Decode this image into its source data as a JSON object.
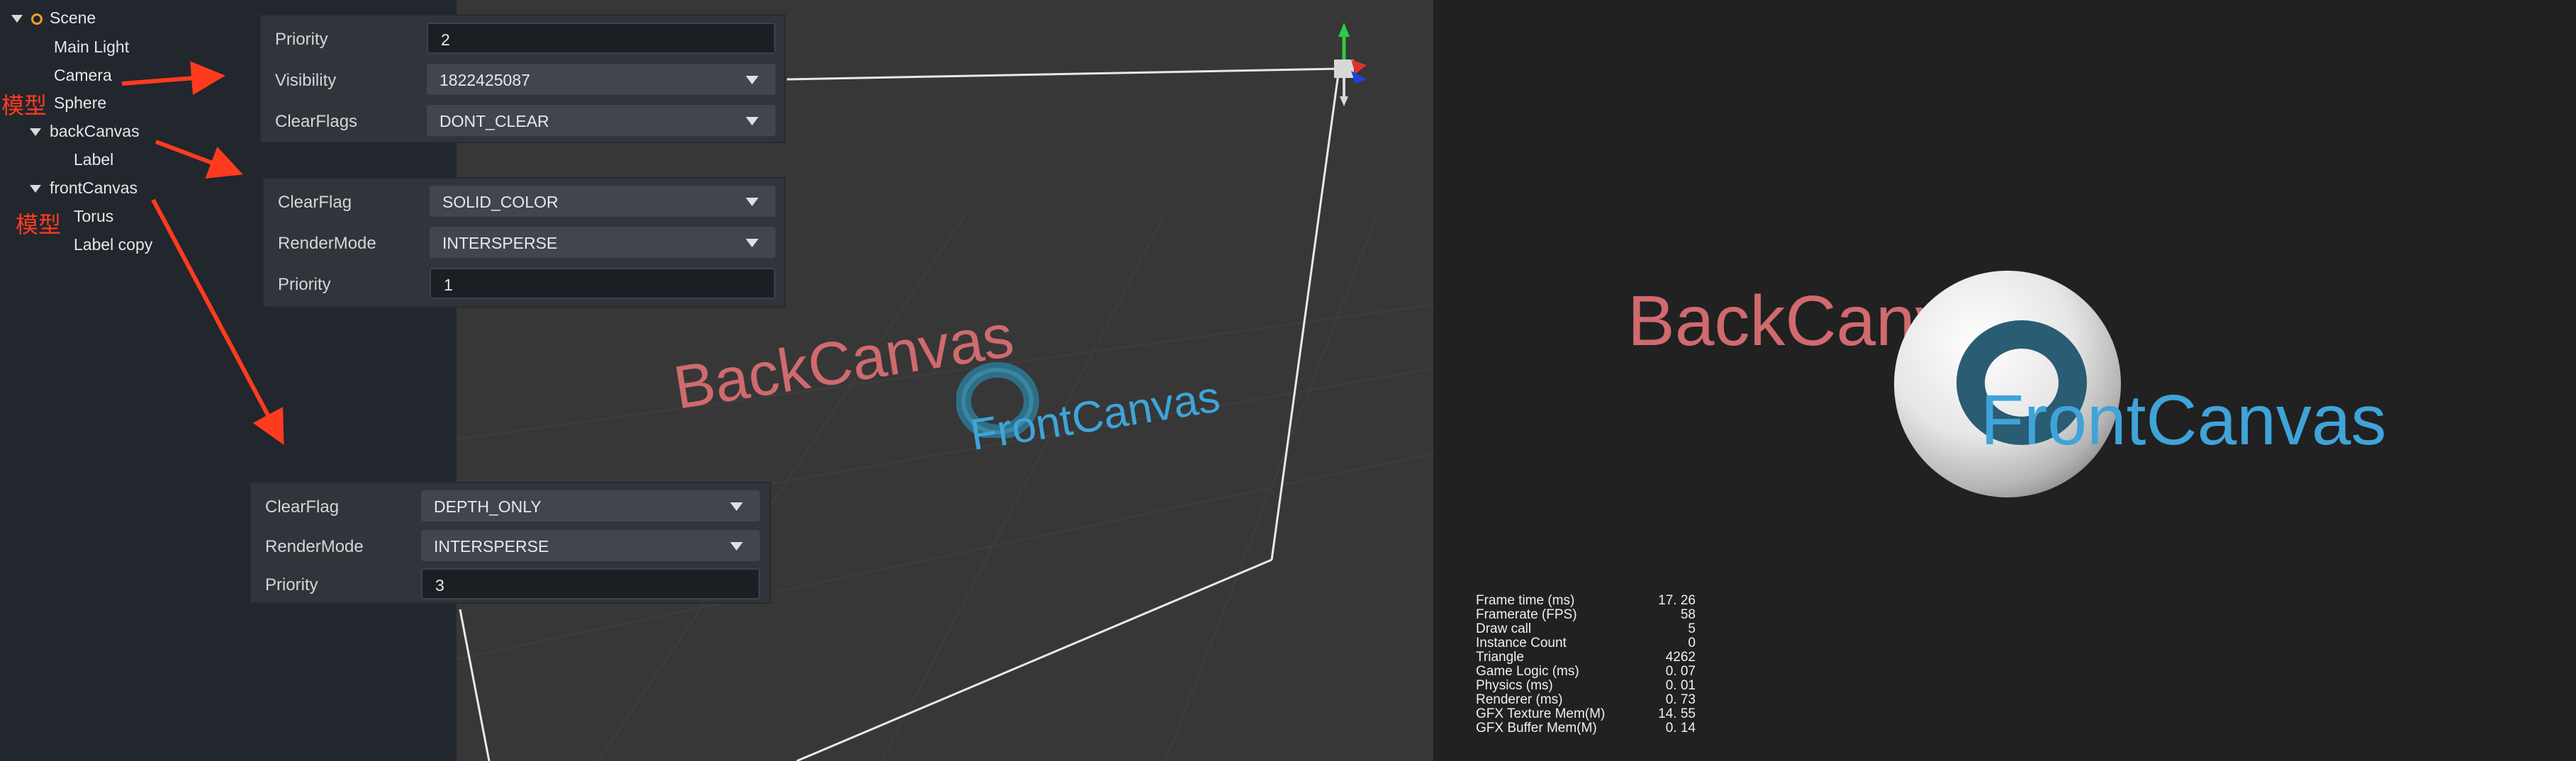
{
  "hierarchy": {
    "items": [
      "Scene",
      "Main Light",
      "Camera",
      "Sphere",
      "backCanvas",
      "Label",
      "frontCanvas",
      "Torus",
      "Label copy"
    ],
    "annotations": [
      "模型",
      "模型"
    ]
  },
  "camera_panel": {
    "rows": [
      {
        "label": "Priority",
        "value": "2"
      },
      {
        "label": "Visibility",
        "value": "1822425087"
      },
      {
        "label": "ClearFlags",
        "value": "DONT_CLEAR"
      }
    ]
  },
  "back_canvas_panel": {
    "rows": [
      {
        "label": "ClearFlag",
        "value": "SOLID_COLOR"
      },
      {
        "label": "RenderMode",
        "value": "INTERSPERSE"
      },
      {
        "label": "Priority",
        "value": "1"
      }
    ]
  },
  "front_canvas_panel": {
    "rows": [
      {
        "label": "ClearFlag",
        "value": "DEPTH_ONLY"
      },
      {
        "label": "RenderMode",
        "value": "INTERSPERSE"
      },
      {
        "label": "Priority",
        "value": "3"
      }
    ]
  },
  "scene": {
    "back_text": "BackCanvas",
    "front_text": "FrontCanvas"
  },
  "game": {
    "back_text": "BackCanvas",
    "front_text": "FrontCanvas"
  },
  "stats": [
    {
      "label": "Frame time (ms)",
      "value": "17. 26"
    },
    {
      "label": "Framerate (FPS)",
      "value": "58"
    },
    {
      "label": "Draw call",
      "value": "5"
    },
    {
      "label": "Instance Count",
      "value": "0"
    },
    {
      "label": "Triangle",
      "value": "4262"
    },
    {
      "label": "Game Logic (ms)",
      "value": "0. 07"
    },
    {
      "label": "Physics (ms)",
      "value": "0. 01"
    },
    {
      "label": "Renderer (ms)",
      "value": "0. 73"
    },
    {
      "label": "GFX Texture Mem(M)",
      "value": "14. 55"
    },
    {
      "label": "GFX Buffer Mem(M)",
      "value": "0. 14"
    }
  ],
  "colors": {
    "back_text": "#d06a6e",
    "front_text": "#3fa4d8",
    "annotation": "#ff3b1f",
    "gizmo_y": "#2ecc40",
    "gizmo_x": "#e03030",
    "gizmo_z": "#2040e0"
  }
}
